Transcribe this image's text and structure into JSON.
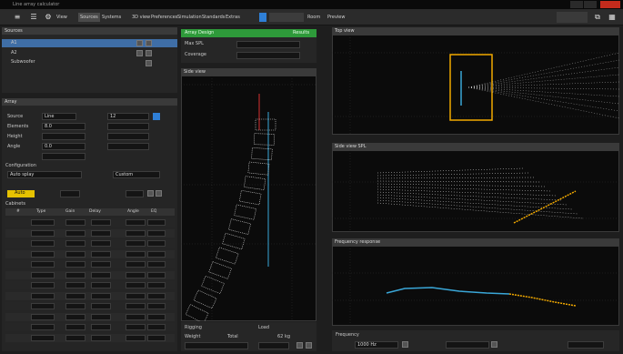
{
  "window": {
    "title": "Line array calculator"
  },
  "toolbar": {
    "items": [
      "View",
      "Sources",
      "Systems",
      "3D view",
      "Preferences",
      "Simulation",
      "Standards",
      "Extras"
    ],
    "center_label": "Room",
    "right_label": "Preview"
  },
  "left_top": {
    "header": "Sources",
    "items": [
      "A1",
      "A2",
      "Subwoofer"
    ]
  },
  "left_mid": {
    "header": "Array",
    "rows": [
      {
        "label": "Source",
        "value": "Line"
      },
      {
        "label": "Elements",
        "value": "12"
      },
      {
        "label": "Height",
        "value": "8.0"
      },
      {
        "label": "Angle",
        "value": "0.0"
      }
    ],
    "config_header": "Configuration",
    "config_value": "Auto splay",
    "config_value2": "Custom",
    "highlight_label": "Auto",
    "table_header": "Cabinets",
    "cols": [
      "#",
      "Type",
      "Gain",
      "Delay",
      "Angle",
      "EQ"
    ]
  },
  "center": {
    "status_left": "Array Design",
    "status_right": "Results",
    "info1_label": "Max SPL",
    "info2_label": "Coverage",
    "plot_header": "Side view",
    "bottom_labels": [
      "Rigging",
      "Load",
      "Weight"
    ],
    "bottom_values": [
      "Total",
      "62 kg"
    ]
  },
  "right": {
    "plot1_header": "Top view",
    "plot2_header": "Side view SPL",
    "plot3_header": "Frequency response",
    "bottom_label": "Frequency",
    "bottom_value": "1000 Hz"
  },
  "colors": {
    "orange": "#f2a900",
    "blue": "#3aa7d8",
    "red": "#d83030",
    "green": "#2e9a3a",
    "accent": "#e6c200"
  }
}
